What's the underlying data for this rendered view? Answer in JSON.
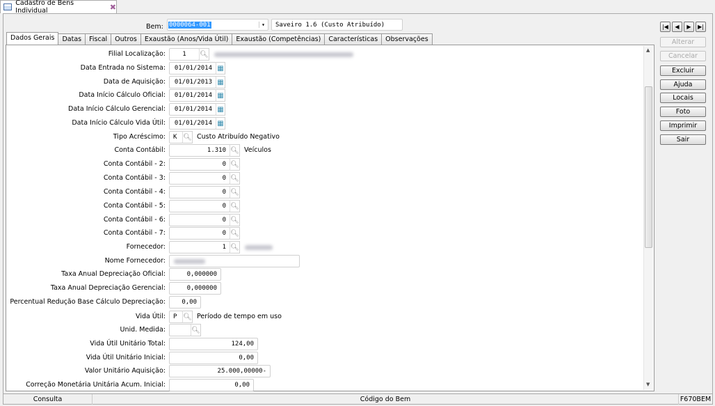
{
  "window": {
    "title": "Cadastro de Bens Individual"
  },
  "header": {
    "bem_label": "Bem:",
    "bem_value": "0000064-001",
    "bem_description": "Saveiro 1.6 (Custo Atribuído)"
  },
  "tabs": [
    "Dados Gerais",
    "Datas",
    "Fiscal",
    "Outros",
    "Exaustão (Anos/Vida Útil)",
    "Exaustão (Competências)",
    "Características",
    "Observações"
  ],
  "fields": [
    {
      "label": "Filial Localização:",
      "value": "1"
    },
    {
      "label": "Data Entrada no Sistema:",
      "value": "01/01/2014"
    },
    {
      "label": "Data de Aquisição:",
      "value": "01/01/2013"
    },
    {
      "label": "Data Início Cálculo Oficial:",
      "value": "01/01/2014"
    },
    {
      "label": "Data Início Cálculo Gerencial:",
      "value": "01/01/2014"
    },
    {
      "label": "Data Início Cálculo Vida Útil:",
      "value": "01/01/2014"
    },
    {
      "label": "Tipo Acréscimo:",
      "value": "K",
      "desc": "Custo Atribuído Negativo"
    },
    {
      "label": "Conta Contábil:",
      "value": "1.310",
      "desc": "Veículos"
    },
    {
      "label": "Conta Contábil - 2:",
      "value": "0"
    },
    {
      "label": "Conta Contábil - 3:",
      "value": "0"
    },
    {
      "label": "Conta Contábil - 4:",
      "value": "0"
    },
    {
      "label": "Conta Contábil - 5:",
      "value": "0"
    },
    {
      "label": "Conta Contábil - 6:",
      "value": "0"
    },
    {
      "label": "Conta Contábil - 7:",
      "value": "0"
    },
    {
      "label": "Fornecedor:",
      "value": "1"
    },
    {
      "label": "Nome Fornecedor:",
      "value": ""
    },
    {
      "label": "Taxa Anual Depreciação Oficial:",
      "value": "0,000000"
    },
    {
      "label": "Taxa Anual Depreciação Gerencial:",
      "value": "0,000000"
    },
    {
      "label": "Percentual Redução Base Cálculo Depreciação:",
      "value": "0,00"
    },
    {
      "label": "Vida Útil:",
      "value": "P",
      "desc": "Período de tempo em uso"
    },
    {
      "label": "Unid. Medida:",
      "value": ""
    },
    {
      "label": "Vida Útil Unitário Total:",
      "value": "124,00"
    },
    {
      "label": "Vida Útil Unitário Inicial:",
      "value": "0,00"
    },
    {
      "label": "Valor Unitário Aquisição:",
      "value": "25.000,00000-"
    },
    {
      "label": "Correção Monetária Unitária Acum. Inicial:",
      "value": "0,00"
    }
  ],
  "buttons": [
    "Alterar",
    "Cancelar",
    "Excluir",
    "Ajuda",
    "Locais",
    "Foto",
    "Imprimir",
    "Sair"
  ],
  "status": {
    "mode": "Consulta",
    "field": "Código do Bem",
    "program": "F670BEM"
  }
}
